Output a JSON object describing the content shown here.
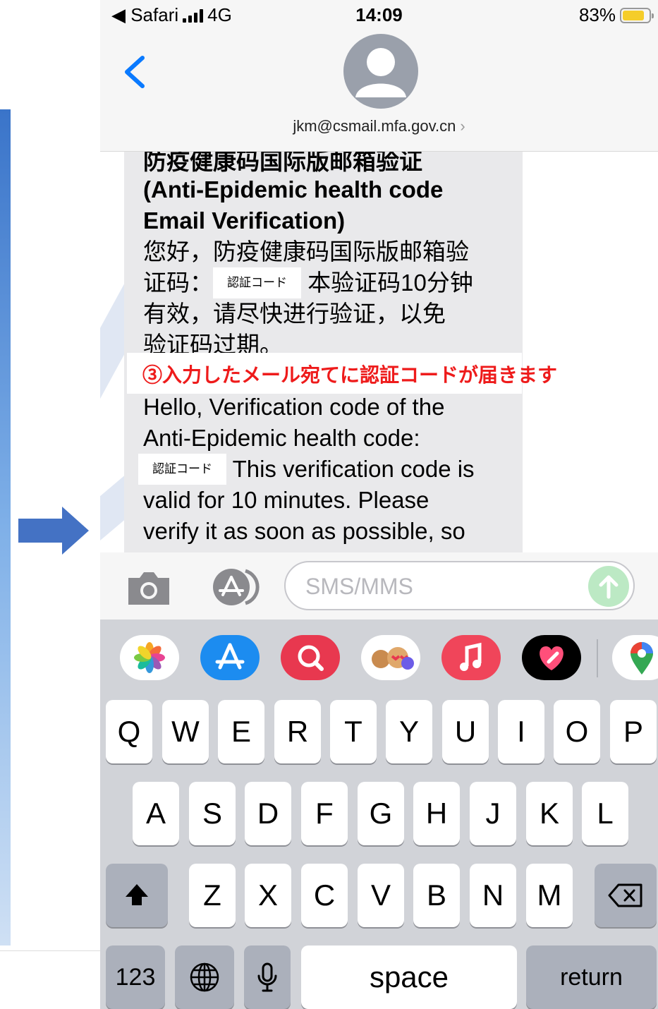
{
  "status_bar": {
    "carrier_back": "◀ Safari",
    "network": "4G",
    "time": "14:09",
    "battery": "83%"
  },
  "header": {
    "sender": "jkm@csmail.mfa.gov.cn",
    "chevron": "›"
  },
  "message": {
    "title_zh": "防疫健康码国际版邮箱验证",
    "title_en_1": "(Anti-Epidemic health code",
    "title_en_2": "Email Verification)",
    "zh_line1": "您好，防疫健康码国际版邮箱验",
    "zh_line2_a": "证码：",
    "code_placeholder": "認証コード",
    "zh_line2_b": "本验证码10分钟",
    "zh_line3": "有效，请尽快进行验证，以免",
    "zh_line4": "验证码过期。",
    "en_line1": "Hello, Verification code of the",
    "en_line2": "Anti-Epidemic health code:",
    "en_line3_b": " This verification code is",
    "en_line4": "valid for 10 minutes. Please",
    "en_line5": "verify it as soon as possible, so"
  },
  "annotation": {
    "text": "③入力したメール宛てに認証コードが届きます",
    "color": "#ee1b1b"
  },
  "input": {
    "placeholder": "SMS/MMS"
  },
  "keyboard": {
    "row1": [
      "Q",
      "W",
      "E",
      "R",
      "T",
      "Y",
      "U",
      "I",
      "O",
      "P"
    ],
    "row2": [
      "A",
      "S",
      "D",
      "F",
      "G",
      "H",
      "J",
      "K",
      "L"
    ],
    "row3": [
      "Z",
      "X",
      "C",
      "V",
      "B",
      "N",
      "M"
    ],
    "numbers": "123",
    "space": "space",
    "return": "return"
  },
  "icons": [
    "camera-icon",
    "appstore-icon",
    "send-icon",
    "photos-icon",
    "appstore-app-icon",
    "search-app-icon",
    "memoji-icon",
    "music-icon",
    "heart-app-icon",
    "maps-icon",
    "shift-icon",
    "delete-icon",
    "globe-icon",
    "mic-icon",
    "back-chevron-icon",
    "avatar-icon",
    "right-arrow-icon"
  ]
}
